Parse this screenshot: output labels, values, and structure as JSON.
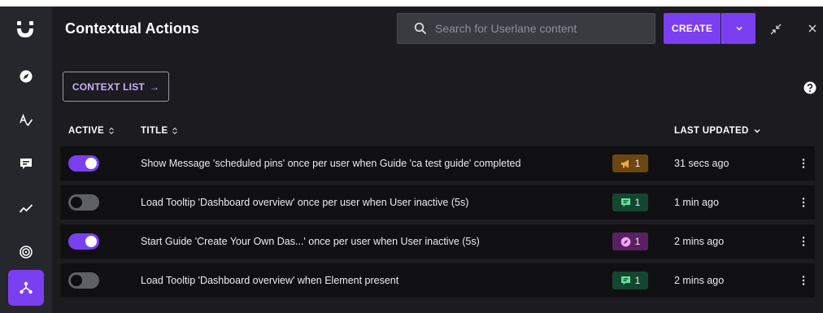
{
  "header": {
    "title": "Contextual Actions",
    "search_placeholder": "Search for Userlane content",
    "create_label": "CREATE"
  },
  "toolbar": {
    "context_list_label": "CONTEXT LIST",
    "context_list_arrow": "→"
  },
  "table": {
    "columns": {
      "active": "ACTIVE",
      "title": "TITLE",
      "last_updated": "LAST UPDATED"
    },
    "rows": [
      {
        "active": true,
        "title": "Show Message 'scheduled pins' once per user when Guide 'ca test guide' completed",
        "badge_type": "message",
        "badge_icon": "megaphone-icon",
        "badge_count": "1",
        "updated": "31 secs ago"
      },
      {
        "active": false,
        "title": "Load Tooltip 'Dashboard overview' once per user when User inactive (5s)",
        "badge_type": "tooltip",
        "badge_icon": "speech-bubble-icon",
        "badge_count": "1",
        "updated": "1 min ago"
      },
      {
        "active": true,
        "title": "Start Guide 'Create Your Own Das...' once per user when User inactive (5s)",
        "badge_type": "guide",
        "badge_icon": "compass-icon",
        "badge_count": "1",
        "updated": "2 mins ago"
      },
      {
        "active": false,
        "title": "Load Tooltip 'Dashboard overview' when Element present",
        "badge_type": "tooltip",
        "badge_icon": "speech-bubble-icon",
        "badge_count": "1",
        "updated": "2 mins ago"
      }
    ]
  },
  "sidebar": {
    "items": [
      "compass-icon",
      "spell-check-icon",
      "speech-bubble-icon",
      "trend-icon",
      "target-icon",
      "hierarchy-icon"
    ],
    "active_item": "hierarchy-icon"
  },
  "colors": {
    "accent": "#7b3ff2",
    "sidebar_bg": "#26262d",
    "main_bg": "#1b1b20",
    "row_bg": "#101013",
    "badge_message": "#6b4612",
    "badge_tooltip": "#14452e",
    "badge_guide": "#5b1f64"
  }
}
